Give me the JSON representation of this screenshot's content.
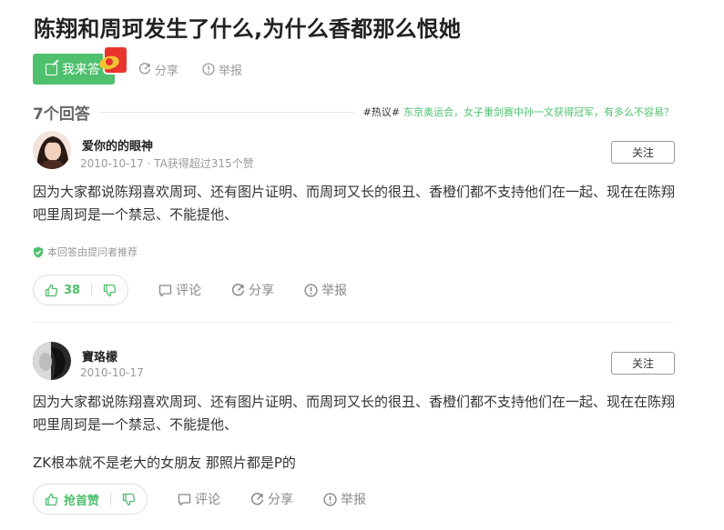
{
  "page_title": "陈翔和周珂发生了什么,为什么香都那么恨她",
  "actions": {
    "answer_label": "我来答",
    "share_label": "分享",
    "report_label": "举报"
  },
  "answers_header": {
    "count_label": "7个回答",
    "hot_tag": "#热议#",
    "hot_topic": "东京奥运会，女子重剑赛中孙一文获得冠军，有多么不容易？"
  },
  "answers": [
    {
      "username": "爱你的的眼神",
      "meta": "2010-10-17 · TA获得超过315个赞",
      "follow_label": "关注",
      "content": "因为大家都说陈翔喜欢周珂、还有图片证明、而周珂又长的很丑、香橙们都不支持他们在一起、现在在陈翔吧里周珂是一个禁忌、不能提他、",
      "recommend": "本回答由提问者推荐",
      "likes": "38",
      "comment_label": "评论",
      "share_label": "分享",
      "report_label": "举报"
    },
    {
      "username": "寶珞檬",
      "meta": "2010-10-17",
      "follow_label": "关注",
      "content": "因为大家都说陈翔喜欢周珂、还有图片证明、而周珂又长的很丑、香橙们都不支持他们在一起、现在在陈翔吧里周珂是一个禁忌、不能提他、",
      "extra": "ZK根本就不是老大的女朋友 那照片都是P的",
      "likes": "抢首赞",
      "comment_label": "评论",
      "share_label": "分享",
      "report_label": "举报"
    }
  ],
  "icons": {
    "edit": "edit-icon",
    "share": "share-icon",
    "report": "report-icon",
    "thumb_up": "thumb-up-icon",
    "thumb_down": "thumb-down-icon",
    "comment": "comment-icon",
    "shield": "shield-check-icon",
    "red_packet": "red-packet-icon"
  },
  "colors": {
    "accent": "#4fc06d",
    "muted": "#999999"
  }
}
